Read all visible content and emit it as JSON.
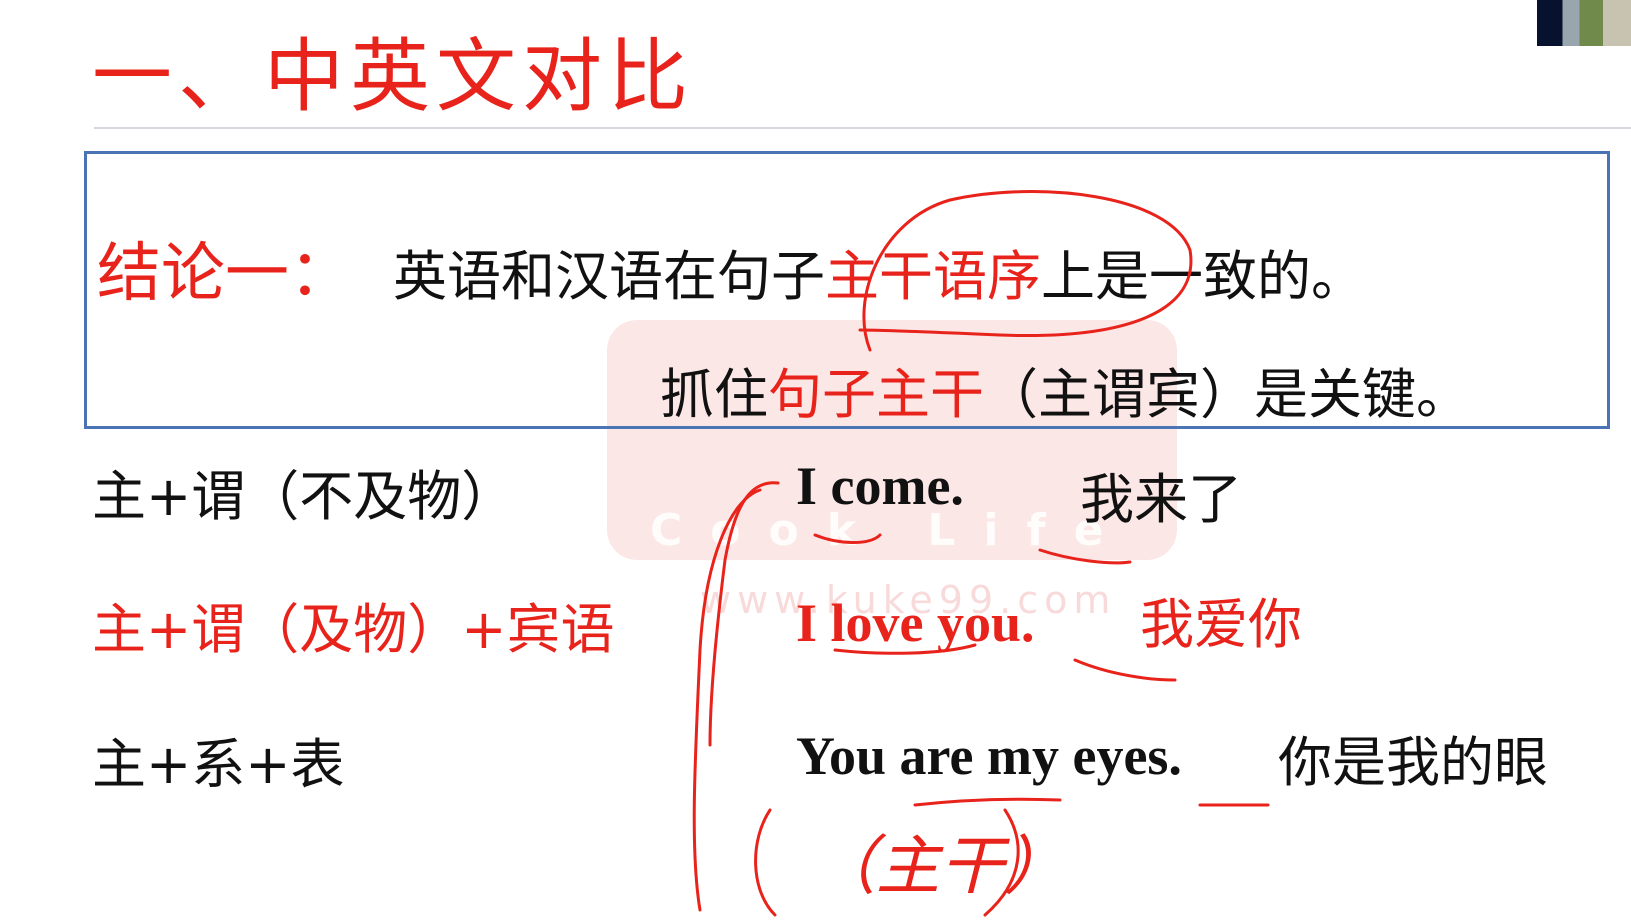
{
  "slide": {
    "title": "一、中英文对比",
    "conclusion": {
      "label": "结论一：",
      "line1_prefix": "英语和汉语在句子",
      "line1_highlight": "主干语序",
      "line1_suffix": "上是一致的。",
      "line2_prefix": "抓住",
      "line2_highlight": "句子主干",
      "line2_suffix": "（主谓宾）是关键。"
    },
    "rows": [
      {
        "pattern": "主+谓（不及物）",
        "english": "I come.",
        "chinese": "我来了",
        "color": "black"
      },
      {
        "pattern": "主+谓（及物）+宾语",
        "english": "I love you.",
        "chinese": "我爱你",
        "color": "red"
      },
      {
        "pattern": "主+系+表",
        "english": "You are my eyes.",
        "chinese": "你是我的眼",
        "color": "black"
      }
    ],
    "annotation": "（主干）"
  },
  "watermark": {
    "text": "Cook Life",
    "url": "www.kuke99.com"
  },
  "colors": {
    "accent_red": "#e8231b",
    "box_border": "#4a74b4",
    "ink": "#e8231b"
  }
}
